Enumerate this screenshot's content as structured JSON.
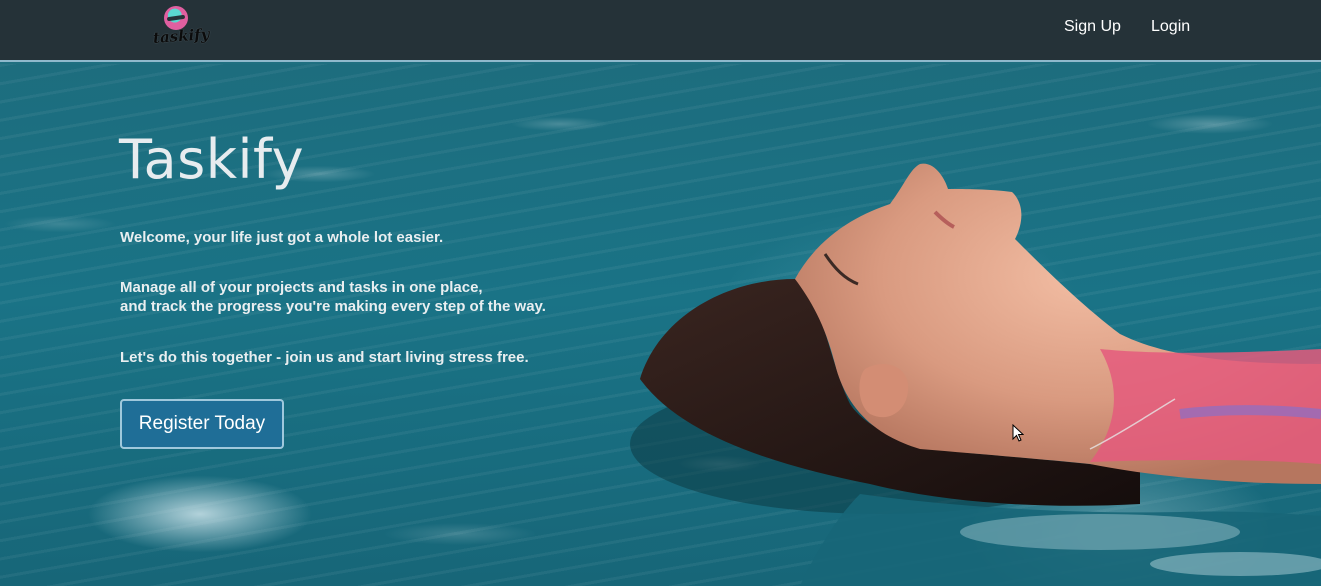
{
  "navbar": {
    "logo_text": "taskify",
    "links": [
      {
        "label": "Sign Up"
      },
      {
        "label": "Login"
      }
    ]
  },
  "hero": {
    "title": "Taskify",
    "welcome": "Welcome, your life just got a whole lot easier.",
    "manage_line1": "Manage all of your projects and tasks in one place,",
    "manage_line2": "and track the progress you're making every step of the way.",
    "together": "Let's do this together - join us and start living stress free.",
    "cta_label": "Register Today"
  },
  "colors": {
    "navbar_bg": "#253238",
    "cta_bg": "#1f6e97",
    "water": "#1a7386"
  }
}
